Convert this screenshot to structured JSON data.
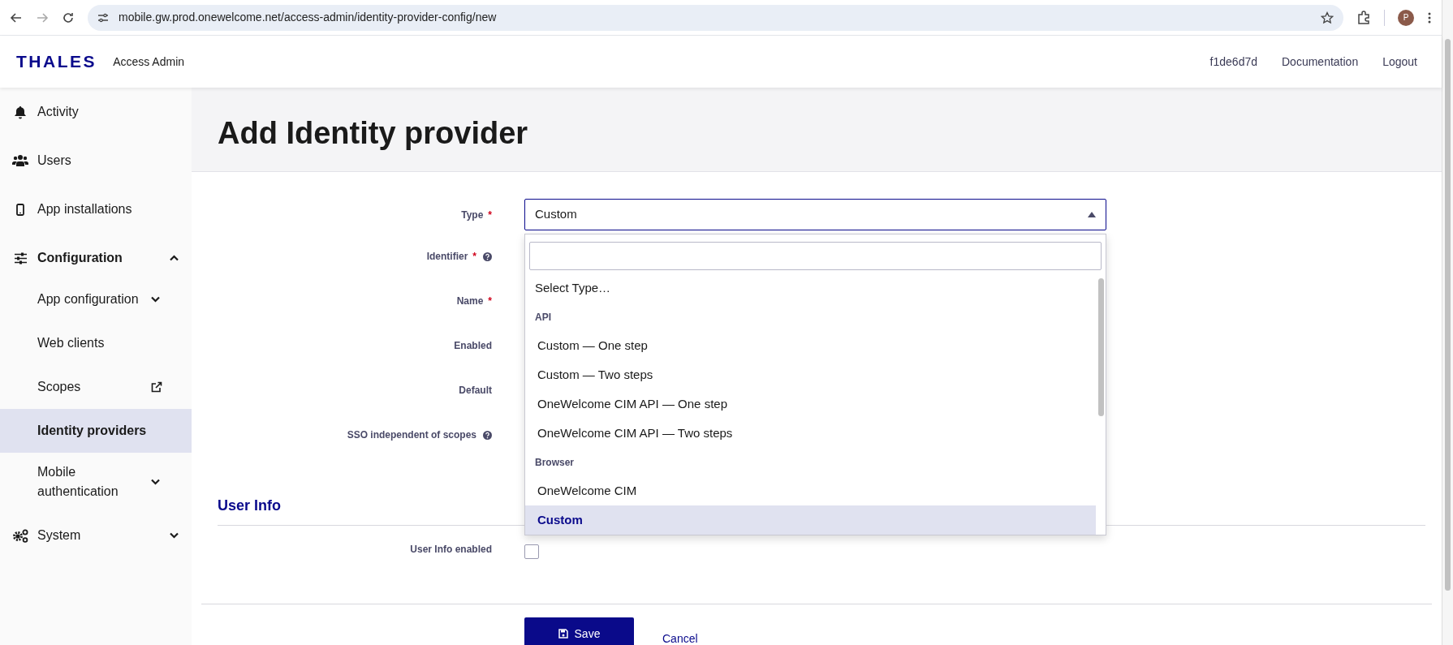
{
  "browser": {
    "url": "mobile.gw.prod.onewelcome.net/access-admin/identity-provider-config/new",
    "profile_initial": "P"
  },
  "header": {
    "logo": "THALES",
    "app_name": "Access Admin",
    "links": [
      "f1de6d7d",
      "Documentation",
      "Logout"
    ]
  },
  "sidebar": {
    "items": [
      {
        "label": "Activity",
        "selected": false
      },
      {
        "label": "Users",
        "selected": false
      },
      {
        "label": "App installations",
        "selected": false
      },
      {
        "label": "Configuration",
        "selected": false,
        "expanded": true,
        "children": [
          {
            "label": "App configuration",
            "selected": false,
            "expanded": false
          },
          {
            "label": "Web clients",
            "selected": false
          },
          {
            "label": "Scopes",
            "selected": false,
            "external": true
          },
          {
            "label": "Identity providers",
            "selected": true
          },
          {
            "label": "Mobile authentication",
            "selected": false,
            "expanded": false
          }
        ]
      },
      {
        "label": "System",
        "selected": false,
        "expanded": false
      }
    ]
  },
  "page_title": "Add Identity provider",
  "form": {
    "fields": [
      {
        "label": "Type",
        "required_mark": "*",
        "help": false,
        "value": "Custom"
      },
      {
        "label": "Identifier",
        "required_mark": "*",
        "help": true
      },
      {
        "label": "Name",
        "required_mark": "*",
        "help": false
      },
      {
        "label": "Enabled",
        "help": false
      },
      {
        "label": "Default",
        "help": false
      },
      {
        "label": "SSO independent of scopes",
        "help": true
      }
    ],
    "dropdown": {
      "options": [
        {
          "kind": "option",
          "label": "Select Type…",
          "selected": false
        },
        {
          "kind": "group",
          "label": "API"
        },
        {
          "kind": "option",
          "label": "Custom — One step",
          "selected": false
        },
        {
          "kind": "option",
          "label": "Custom — Two steps",
          "selected": false
        },
        {
          "kind": "option",
          "label": "OneWelcome CIM API — One step",
          "selected": false
        },
        {
          "kind": "option",
          "label": "OneWelcome CIM API — Two steps",
          "selected": false
        },
        {
          "kind": "group",
          "label": "Browser"
        },
        {
          "kind": "option",
          "label": "OneWelcome CIM",
          "selected": false
        },
        {
          "kind": "option",
          "label": "Custom",
          "selected": true
        }
      ]
    }
  },
  "user_info": {
    "heading": "User Info",
    "fields": [
      {
        "label": "User Info enabled",
        "checked": false
      }
    ]
  },
  "buttons": {
    "save": "Save",
    "cancel": "Cancel"
  }
}
